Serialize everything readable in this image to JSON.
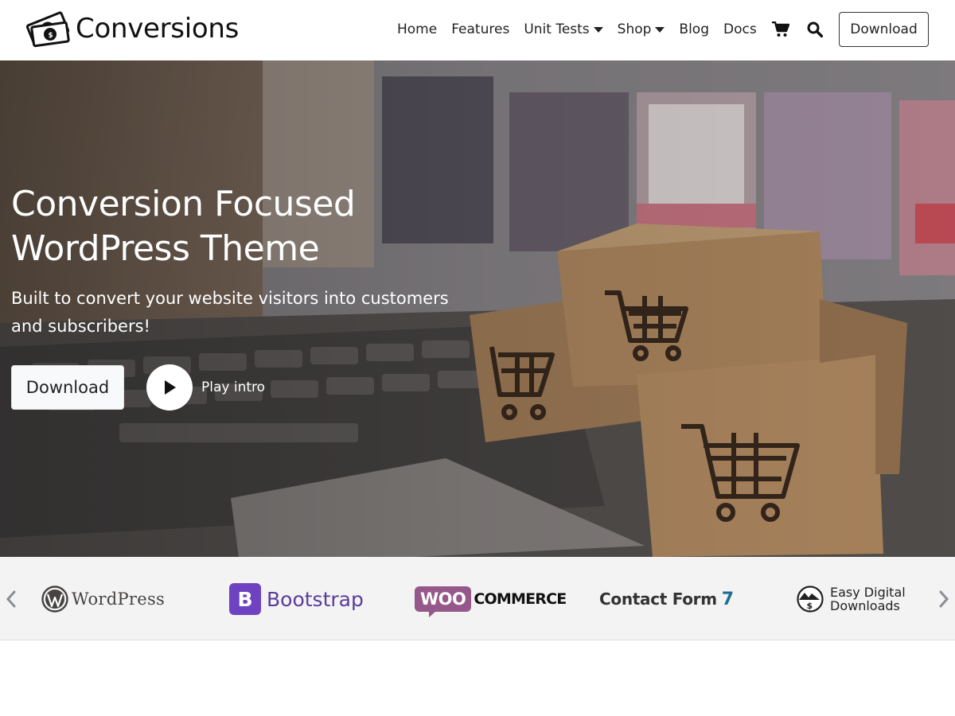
{
  "header": {
    "brand_name": "Conversions",
    "nav": [
      {
        "label": "Home",
        "has_dropdown": false
      },
      {
        "label": "Features",
        "has_dropdown": false
      },
      {
        "label": "Unit Tests",
        "has_dropdown": true
      },
      {
        "label": "Shop",
        "has_dropdown": true
      },
      {
        "label": "Blog",
        "has_dropdown": false
      },
      {
        "label": "Docs",
        "has_dropdown": false
      }
    ],
    "icons": [
      "cart-icon",
      "search-icon"
    ],
    "download_label": "Download"
  },
  "hero": {
    "title_line1": "Conversion Focused",
    "title_line2": "WordPress Theme",
    "subtitle_line1": "Built to convert your website visitors into customers",
    "subtitle_line2": "and subscribers!",
    "download_label": "Download",
    "play_label": "Play intro"
  },
  "logos": {
    "items": [
      {
        "name": "wordpress",
        "label": "WordPress"
      },
      {
        "name": "bootstrap",
        "mark": "B",
        "label": "Bootstrap"
      },
      {
        "name": "woocommerce",
        "mark": "WOO",
        "label": "COMMERCE"
      },
      {
        "name": "contact-form-7",
        "label": "Contact Form",
        "number": "7"
      },
      {
        "name": "easy-digital-downloads",
        "label_line1": "Easy Digital",
        "label_line2": "Downloads"
      }
    ]
  },
  "colors": {
    "bootstrap_purple": "#6f42c1",
    "woo_purple": "#96588a",
    "cf7_blue": "#1f6e92",
    "strip_bg": "#f3f3f3"
  }
}
